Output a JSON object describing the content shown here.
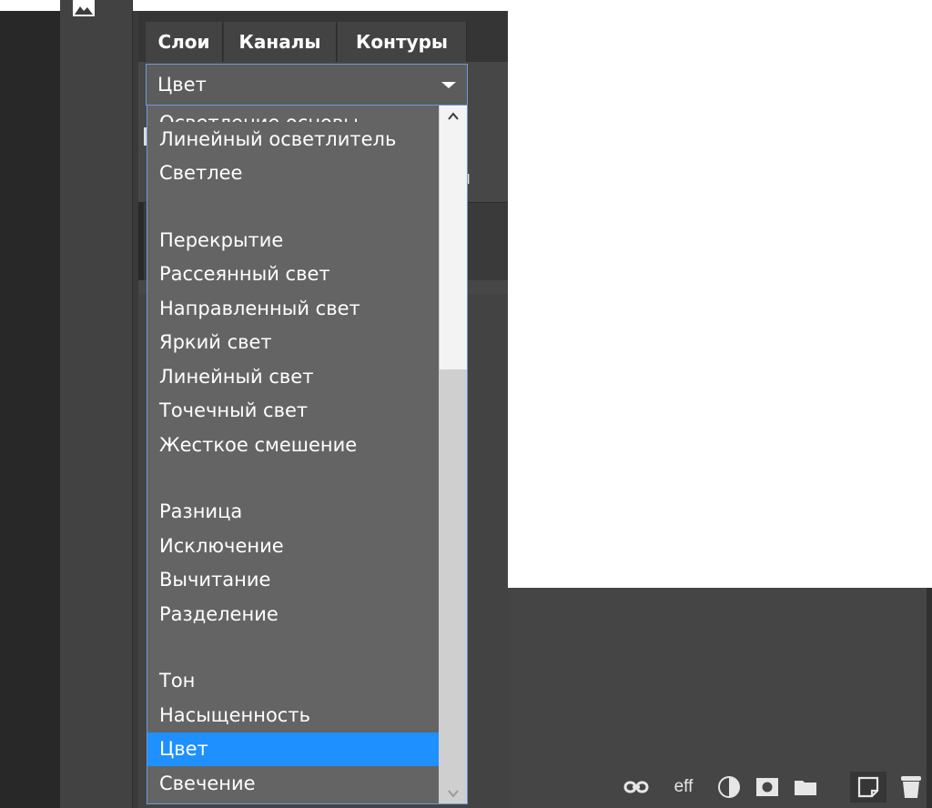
{
  "tabs": [
    {
      "label": "Слои"
    },
    {
      "label": "Каналы"
    },
    {
      "label": "Контуры"
    }
  ],
  "settings": {
    "partial_label": "ия"
  },
  "blend_mode": {
    "selected": "Цвет"
  },
  "dropdown": {
    "partial_top": "Осветление основы",
    "items": [
      "Линейный осветлитель",
      "Светлее",
      "",
      "Перекрытие",
      "Рассеянный свет",
      "Направленный свет",
      "Яркий свет",
      "Линейный свет",
      "Точечный свет",
      "Жесткое смешение",
      "",
      "Разница",
      "Исключение",
      "Вычитание",
      "Разделение",
      "",
      "Тон",
      "Насыщенность",
      "Цвет",
      "Свечение"
    ],
    "selected_index": 18
  },
  "bottom_bar": {
    "eff_label": "eff",
    "icons": [
      "link-icon",
      "effects-icon",
      "adjustment-icon",
      "mask-icon",
      "folder-icon",
      "new-layer-icon",
      "trash-icon"
    ]
  },
  "colors": {
    "accent": "#1e90ff",
    "panel": "#434343",
    "dropdown_bg": "#646464",
    "border_focus": "#6b9cd6"
  }
}
